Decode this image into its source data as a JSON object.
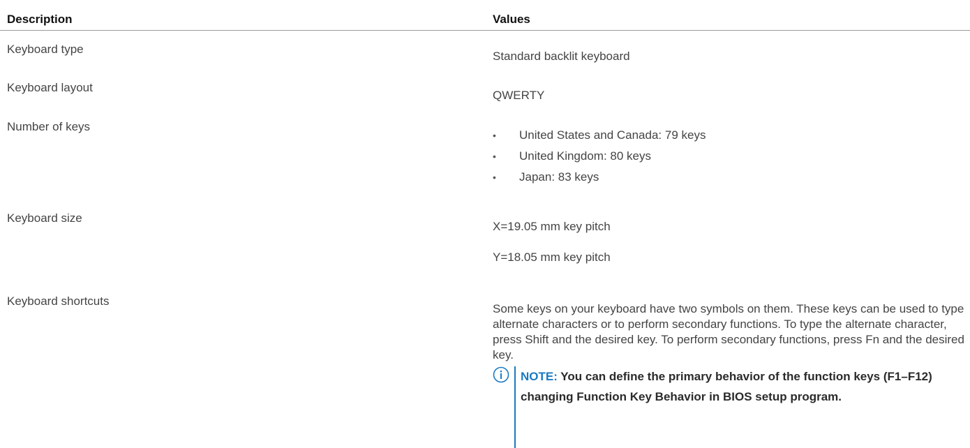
{
  "table": {
    "headers": {
      "description": "Description",
      "values": "Values"
    },
    "rows": [
      {
        "label": "Keyboard type",
        "value": "Standard backlit keyboard"
      },
      {
        "label": "Keyboard layout",
        "value": "QWERTY"
      },
      {
        "label": "Number of keys",
        "bullet_symbol": "•",
        "items": [
          "United States and Canada: 79 keys",
          "United Kingdom: 80 keys",
          "Japan: 83 keys"
        ]
      },
      {
        "label": "Keyboard size",
        "values": [
          "X=19.05 mm key pitch",
          "Y=18.05 mm key pitch"
        ]
      },
      {
        "label": "Keyboard shortcuts",
        "paragraph": "Some keys on your keyboard have two symbols on them. These keys can be used to type alternate characters or to perform secondary functions. To type the alternate character, press Shift and the desired key. To perform secondary functions, press Fn and the desired key.",
        "note": {
          "icon": "info-icon",
          "label": "NOTE:",
          "text": " You can define the primary behavior of the function keys (F1–F12) changing Function Key Behavior in BIOS setup program."
        }
      }
    ]
  },
  "colors": {
    "text": "#444444",
    "header_text": "#111111",
    "note_accent": "#1a7ac1",
    "divider": "#9a9a9a"
  }
}
